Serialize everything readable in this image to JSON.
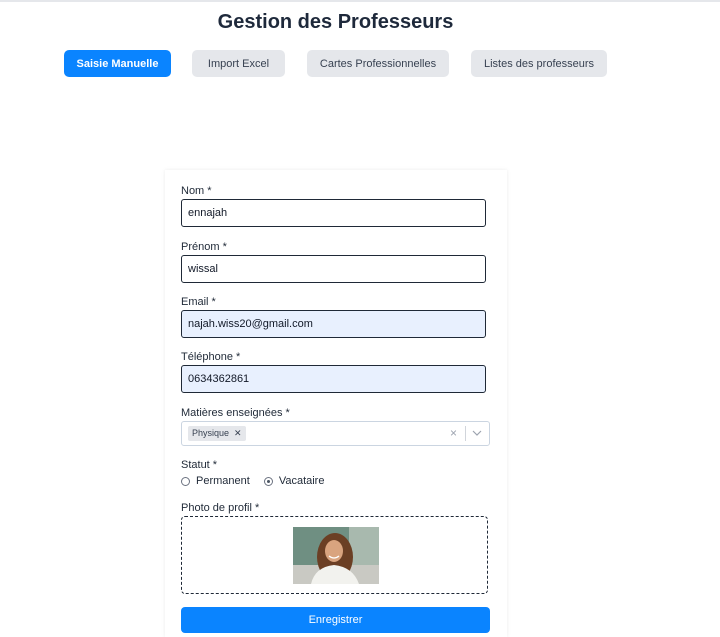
{
  "page_title": "Gestion des Professeurs",
  "tabs": [
    {
      "label": "Saisie Manuelle",
      "active": true
    },
    {
      "label": "Import Excel",
      "active": false
    },
    {
      "label": "Cartes Professionnelles",
      "active": false
    },
    {
      "label": "Listes des professeurs",
      "active": false
    }
  ],
  "form": {
    "nom": {
      "label": "Nom *",
      "value": "ennajah"
    },
    "prenom": {
      "label": "Prénom *",
      "value": "wissal"
    },
    "email": {
      "label": "Email *",
      "value": "najah.wiss20@gmail.com"
    },
    "telephone": {
      "label": "Téléphone *",
      "value": "0634362861"
    },
    "matieres": {
      "label": "Matières enseignées *",
      "selected": [
        "Physique"
      ],
      "chip_remove_icon": "close-icon",
      "clear_icon": "clear-icon",
      "dropdown_icon": "chevron-down-icon"
    },
    "statut": {
      "label": "Statut *",
      "options": [
        {
          "label": "Permanent",
          "checked": false
        },
        {
          "label": "Vacataire",
          "checked": true
        }
      ]
    },
    "photo": {
      "label": "Photo de profil *"
    },
    "submit_label": "Enregistrer"
  },
  "colors": {
    "primary": "#0a84ff",
    "tab_inactive": "#e5e7eb",
    "autofill_bg": "#e8f0fe",
    "title": "#1e293b"
  }
}
